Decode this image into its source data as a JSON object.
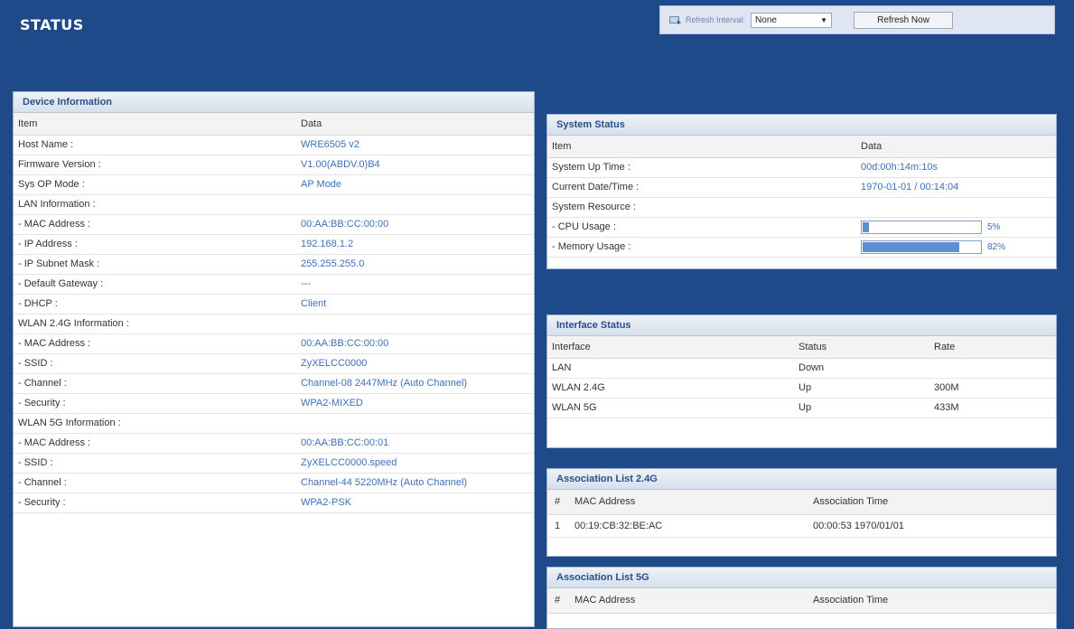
{
  "page": {
    "title": "STATUS"
  },
  "refresh": {
    "interval_label": "Refresh Interval:",
    "interval_value": "None",
    "refresh_button": "Refresh Now"
  },
  "device_info": {
    "title": "Device Information",
    "col_item": "Item",
    "col_data": "Data",
    "rows": [
      {
        "item": "Host Name :",
        "data": "WRE6505 v2"
      },
      {
        "item": "Firmware Version :",
        "data": "V1.00(ABDV.0)B4"
      },
      {
        "item": "Sys OP Mode :",
        "data": "AP Mode"
      },
      {
        "item": "LAN Information :",
        "data": ""
      },
      {
        "item": " - MAC Address :",
        "data": "00:AA:BB:CC:00:00"
      },
      {
        "item": " - IP Address :",
        "data": "192.168.1.2"
      },
      {
        "item": " - IP Subnet Mask :",
        "data": "255.255.255.0"
      },
      {
        "item": " - Default Gateway :",
        "data": "---"
      },
      {
        "item": " - DHCP :",
        "data": "Client"
      },
      {
        "item": "WLAN 2.4G Information :",
        "data": ""
      },
      {
        "item": " - MAC Address :",
        "data": "00:AA:BB:CC:00:00"
      },
      {
        "item": " - SSID :",
        "data": "ZyXELCC0000"
      },
      {
        "item": " - Channel :",
        "data": "Channel-08 2447MHz  (Auto Channel)"
      },
      {
        "item": " - Security :",
        "data": "WPA2-MIXED"
      },
      {
        "item": "WLAN 5G Information :",
        "data": ""
      },
      {
        "item": " - MAC Address :",
        "data": "00:AA:BB:CC:00:01"
      },
      {
        "item": " - SSID :",
        "data": "ZyXELCC0000.speed"
      },
      {
        "item": " - Channel :",
        "data": "Channel-44 5220MHz  (Auto Channel)"
      },
      {
        "item": " - Security :",
        "data": "WPA2-PSK"
      }
    ]
  },
  "system_status": {
    "title": "System Status",
    "col_item": "Item",
    "col_data": "Data",
    "uptime_label": "System Up Time :",
    "uptime_value": "00d:00h:14m:10s",
    "datetime_label": "Current Date/Time :",
    "datetime_value": "1970-01-01 / 00:14:04",
    "resource_label": "System Resource :",
    "cpu_label": " - CPU Usage :",
    "cpu_percent": 5,
    "cpu_text": "5%",
    "memory_label": " - Memory Usage :",
    "memory_percent": 82,
    "memory_text": "82%"
  },
  "interface_status": {
    "title": "Interface Status",
    "col_interface": "Interface",
    "col_status": "Status",
    "col_rate": "Rate",
    "rows": [
      {
        "interface": "LAN",
        "status": "Down",
        "rate": ""
      },
      {
        "interface": "WLAN 2.4G",
        "status": "Up",
        "rate": "300M"
      },
      {
        "interface": "WLAN 5G",
        "status": "Up",
        "rate": "433M"
      }
    ]
  },
  "assoc_24g": {
    "title": "Association List 2.4G",
    "col_num": "#",
    "col_mac": "MAC Address",
    "col_time": "Association Time",
    "rows": [
      {
        "num": "1",
        "mac": "00:19:CB:32:BE:AC",
        "time": "00:00:53   1970/01/01"
      }
    ]
  },
  "assoc_5g": {
    "title": "Association List 5G",
    "col_num": "#",
    "col_mac": "MAC Address",
    "col_time": "Association Time"
  },
  "colors": {
    "background": "#1f4a8a",
    "panel_title": "#2a4f86",
    "value_text": "#3f70b8",
    "bar_fill": "#5d8ed0"
  }
}
